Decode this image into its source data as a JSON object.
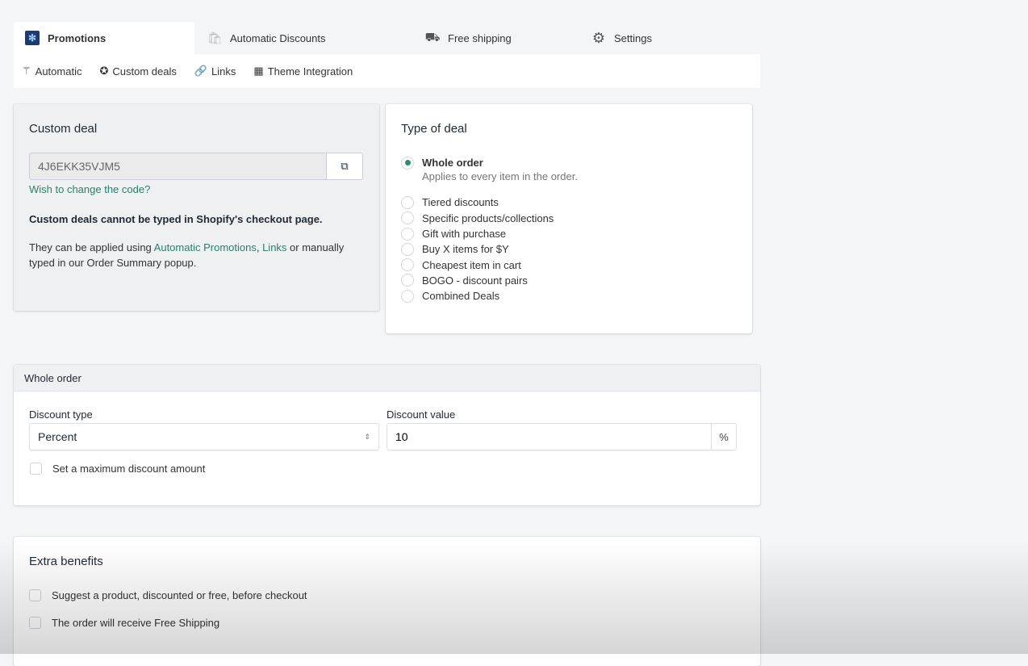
{
  "tabs": [
    {
      "label": "Promotions",
      "icon": "promotions-logo-icon",
      "active": true
    },
    {
      "label": "Automatic Discounts",
      "icon": "shopify-bag-icon"
    },
    {
      "label": "Free shipping",
      "icon": "truck-icon"
    },
    {
      "label": "Settings",
      "icon": "gear-icon"
    }
  ],
  "subnav": [
    {
      "label": "Automatic",
      "icon": "magic-wand-icon"
    },
    {
      "label": "Custom deals",
      "icon": "badge-percent-icon"
    },
    {
      "label": "Links",
      "icon": "link-icon"
    },
    {
      "label": "Theme Integration",
      "icon": "layout-icon"
    }
  ],
  "custom_deal": {
    "title": "Custom deal",
    "code": "4J6EKK35VJM5",
    "change_link": "Wish to change the code?",
    "warning": "Custom deals cannot be typed in Shopify's checkout page.",
    "info_pre": "They can be applied using ",
    "link_auto": "Automatic Promotions",
    "sep": ", ",
    "link_links": "Links",
    "info_post": " or manually typed in our Order Summary popup."
  },
  "type_of_deal": {
    "title": "Type of deal",
    "selected": "Whole order",
    "selected_desc": "Applies to every item in the order.",
    "options": [
      "Tiered discounts",
      "Specific products/collections",
      "Gift with purchase",
      "Buy X items for $Y",
      "Cheapest item in cart",
      "BOGO - discount pairs",
      "Combined Deals"
    ]
  },
  "whole_order": {
    "header": "Whole order",
    "discount_type_label": "Discount type",
    "discount_type": "Percent",
    "discount_value_label": "Discount value",
    "discount_value": "10",
    "unit": "%",
    "max_label": "Set a maximum discount amount",
    "max_checked": false
  },
  "extra": {
    "title": "Extra benefits",
    "items": [
      {
        "label": "Suggest a product, discounted or free, before checkout",
        "checked": false
      },
      {
        "label": "The order will receive Free Shipping",
        "checked": false
      }
    ]
  },
  "colors": {
    "accent": "#2e8b6e",
    "link": "#2e7d6e"
  }
}
